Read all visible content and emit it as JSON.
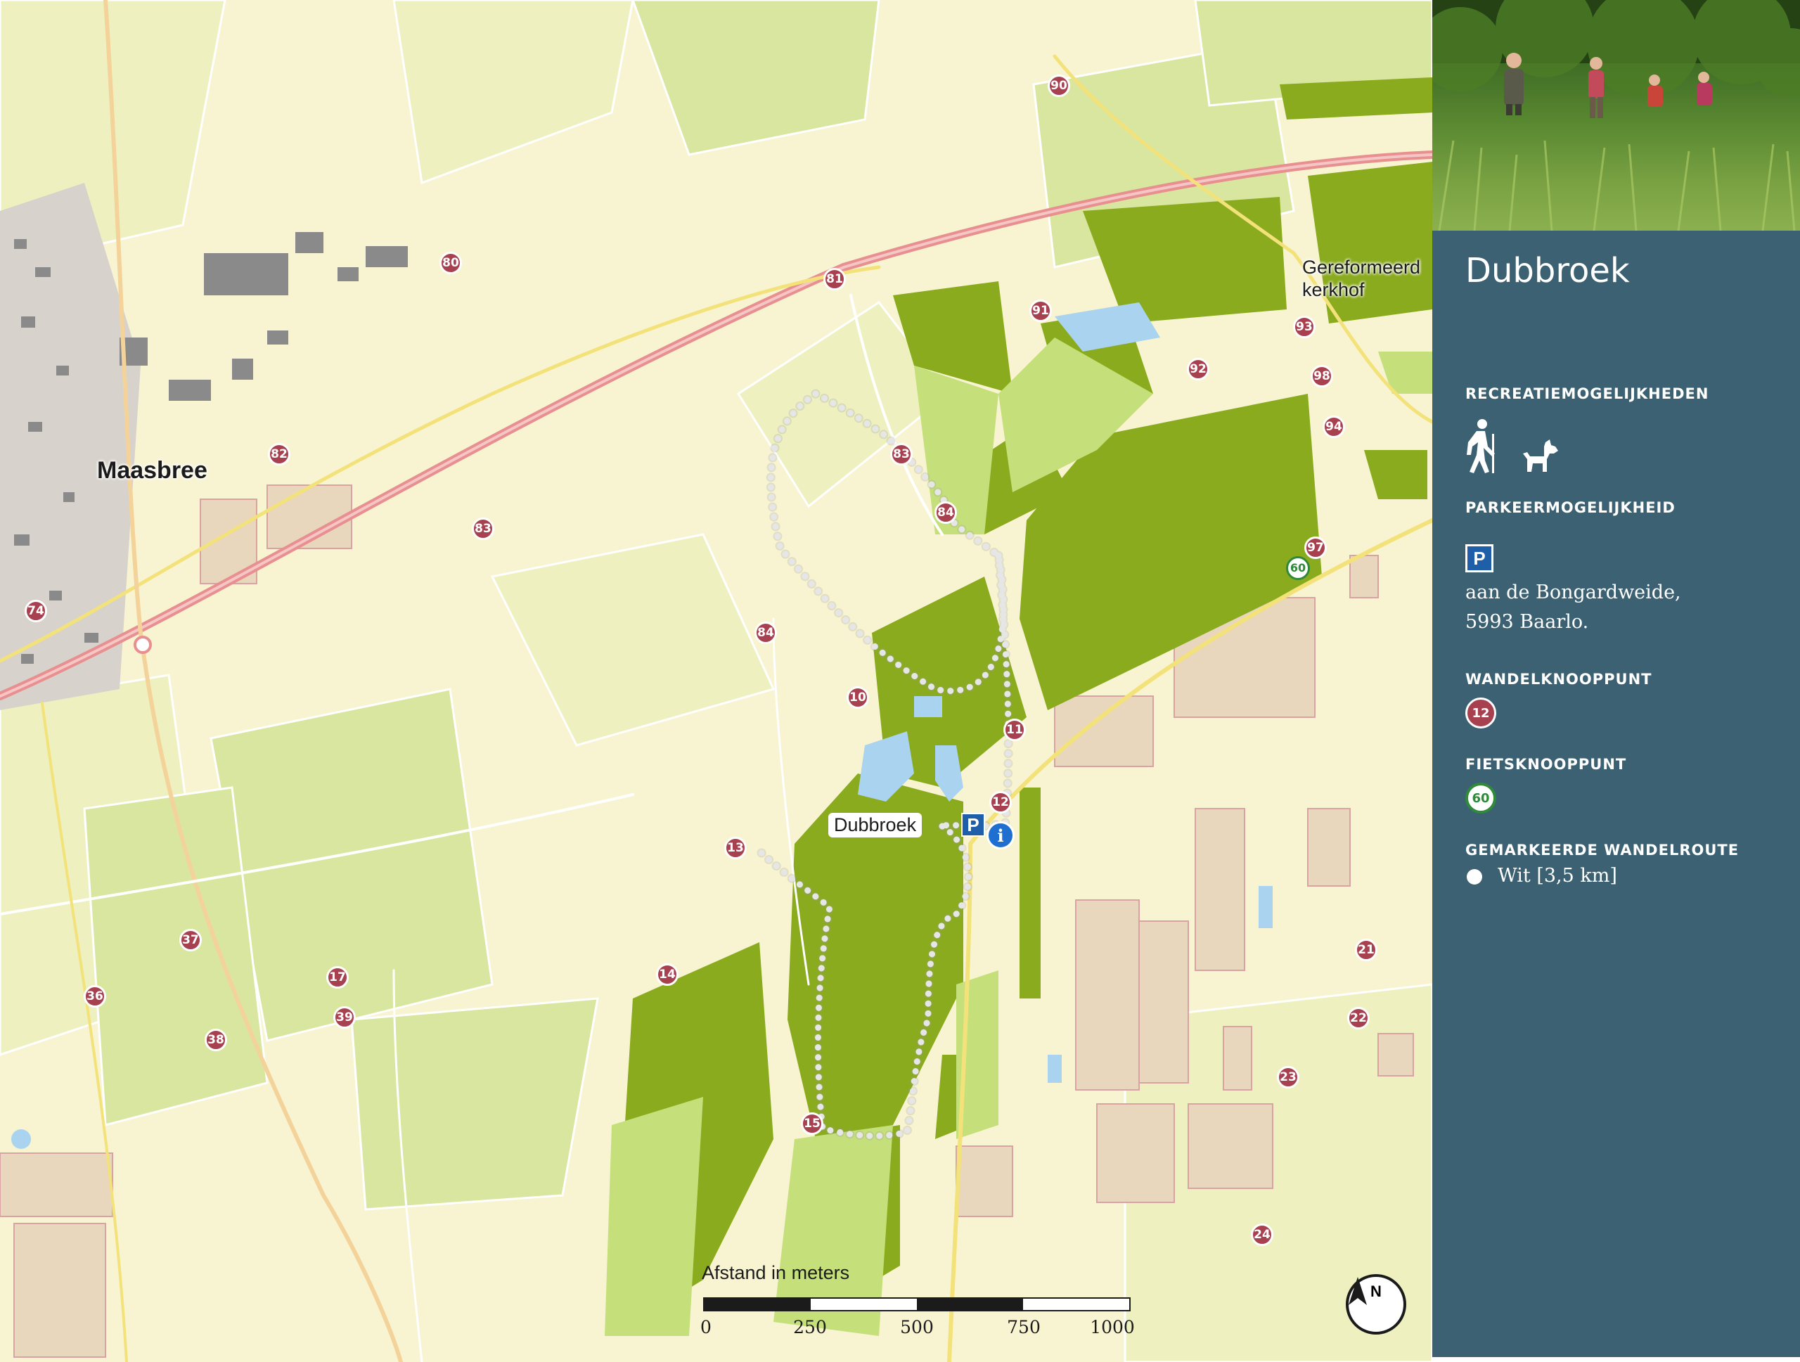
{
  "map": {
    "town_label": "Maasbree",
    "poi_label_line1": "Gereformeerd",
    "poi_label_line2": "kerkhof",
    "route_label": "Dubbroek",
    "parking_marker": "P",
    "info_marker": "i",
    "walking_nodes": [
      "90",
      "80",
      "81",
      "91",
      "93",
      "92",
      "98",
      "94",
      "82",
      "83",
      "83",
      "84",
      "84",
      "97",
      "74",
      "10",
      "11",
      "12",
      "13",
      "37",
      "36",
      "17",
      "39",
      "38",
      "14",
      "15",
      "21",
      "22",
      "23",
      "24"
    ],
    "cycling_nodes": [
      "60"
    ],
    "scale": {
      "title": "Afstand in meters",
      "ticks": [
        "0",
        "250",
        "500",
        "750",
        "1000"
      ]
    },
    "north_label": "N",
    "colors": {
      "background": "#f8f4d2",
      "forest_dark": "#8aab1d",
      "forest_light": "#c5e07a",
      "built_area": "#e8d6bd",
      "road_main": "#e88f8f",
      "node": "#a8414f",
      "cycle_node": "#2f8a3a"
    }
  },
  "sidebar": {
    "title": "Dubbroek",
    "recreation_heading": "RECREATIEMOGELIJKHEDEN",
    "recreation_icons": [
      "hiker-icon",
      "dog-icon"
    ],
    "parking_heading": "PARKEERMOGELIJKHEID",
    "parking_icon": "P",
    "parking_address_line1": "aan de Bongardweide,",
    "parking_address_line2": "5993 Baarlo.",
    "walk_node_heading": "WANDELKNOOPPUNT",
    "walk_node_value": "12",
    "bike_node_heading": "FIETSKNOOPPUNT",
    "bike_node_value": "60",
    "route_heading": "GEMARKEERDE WANDELROUTE",
    "route_value": "Wit [3,5 km]",
    "panel_color": "#3c6172"
  }
}
